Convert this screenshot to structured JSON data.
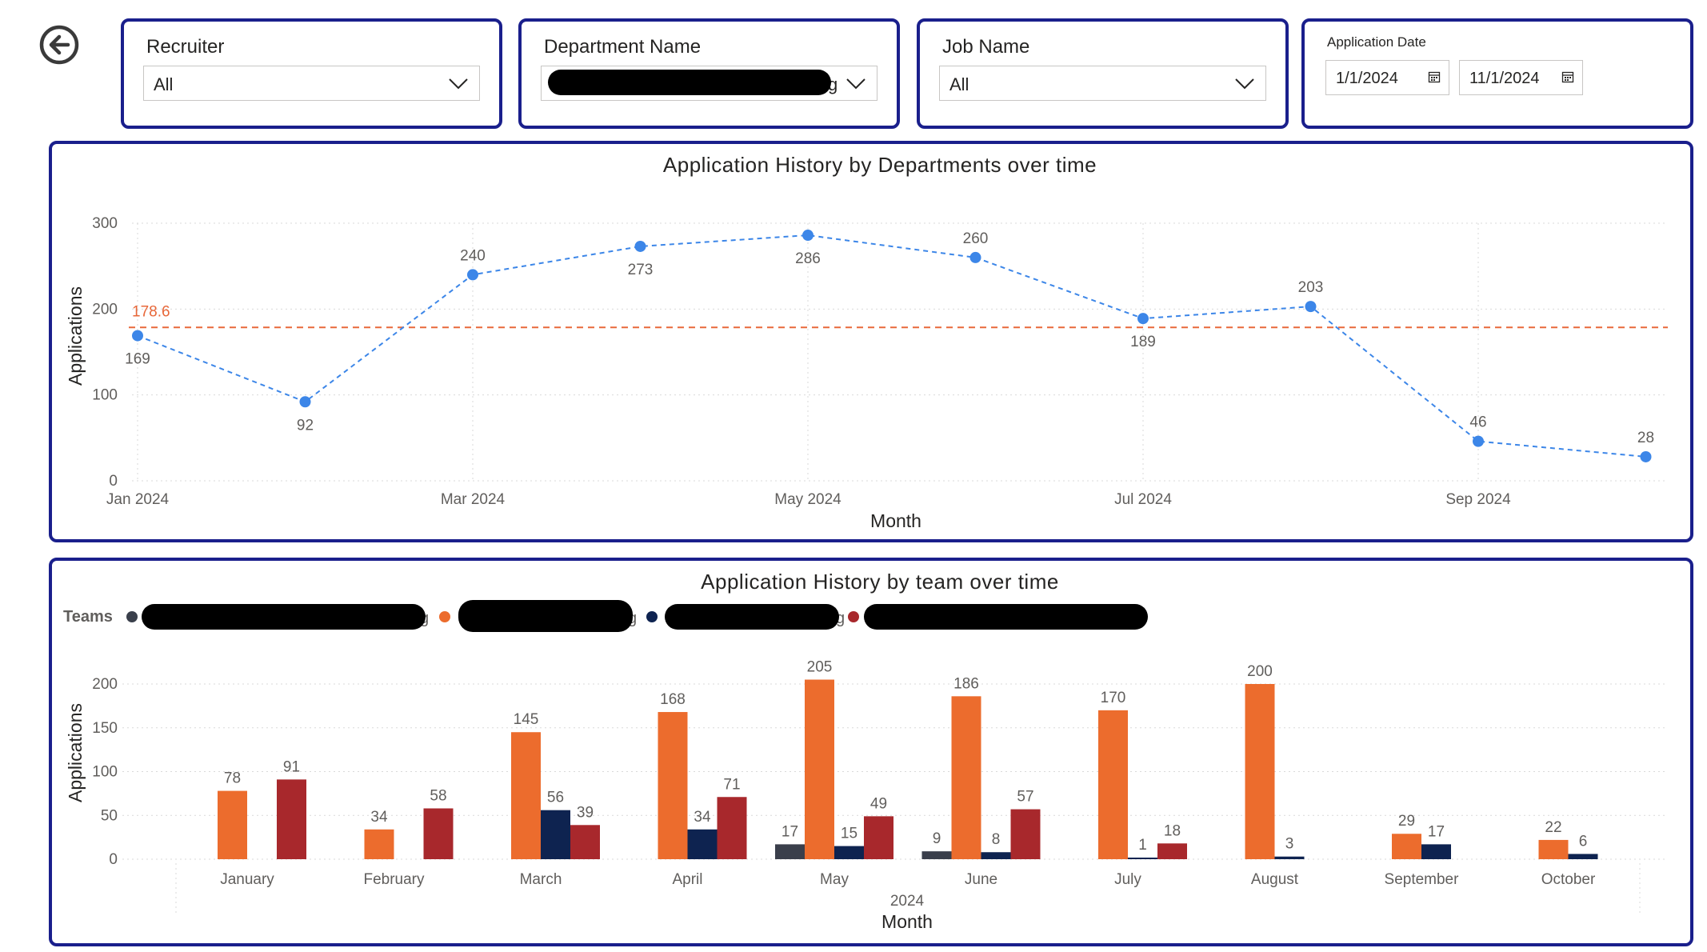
{
  "filters": {
    "recruiter": {
      "title": "Recruiter",
      "value": "All"
    },
    "department": {
      "title": "Department Name",
      "value_visible_fragment": "g"
    },
    "job": {
      "title": "Job Name",
      "value": "All"
    },
    "application_date": {
      "title": "Application Date",
      "start": "1/1/2024",
      "end": "11/1/2024"
    }
  },
  "icons": {
    "back": "back-arrow-circle-icon",
    "dropdown": "chevron-down-icon",
    "calendar": "calendar-icon"
  },
  "colors": {
    "panel_border": "#1a1f8c",
    "line_series": "#3c86e8",
    "average_line": "#e8683a",
    "team_dark_gray": "#3a3f4b",
    "team_orange": "#ec6c2d",
    "team_navy": "#0e2350",
    "team_red": "#a8282c"
  },
  "chart_data": [
    {
      "type": "line",
      "title": "Application History by Departments over time",
      "xlabel": "Month",
      "ylabel": "Applications",
      "x": [
        "Jan 2024",
        "Feb 2024",
        "Mar 2024",
        "Apr 2024",
        "May 2024",
        "Jun 2024",
        "Jul 2024",
        "Aug 2024",
        "Sep 2024",
        "Oct 2024"
      ],
      "x_tick_labels": [
        "Jan 2024",
        "Mar 2024",
        "May 2024",
        "Jul 2024",
        "Sep 2024"
      ],
      "values": [
        169,
        92,
        240,
        273,
        286,
        260,
        189,
        203,
        46,
        28
      ],
      "average": 178.6,
      "ylim": [
        0,
        300
      ],
      "yticks": [
        0,
        100,
        200,
        300
      ],
      "grid": true,
      "line_style": "dashed"
    },
    {
      "type": "bar",
      "title": "Application History by team over time",
      "legend_title": "Teams",
      "legend_placement": "top-left",
      "xlabel": "Month",
      "x_group_label": "2024",
      "ylabel": "Applications",
      "categories": [
        "January",
        "February",
        "March",
        "April",
        "May",
        "June",
        "July",
        "August",
        "September",
        "October"
      ],
      "ylim": [
        0,
        200
      ],
      "yticks": [
        0,
        50,
        100,
        150,
        200
      ],
      "grid": true,
      "series": [
        {
          "legend_visible_fragment": "g",
          "color": "#3a3f4b",
          "values": [
            null,
            null,
            null,
            null,
            17,
            9,
            null,
            null,
            null,
            null
          ]
        },
        {
          "legend_visible_fragment": "g",
          "color": "#ec6c2d",
          "values": [
            78,
            34,
            145,
            168,
            205,
            186,
            170,
            200,
            29,
            22
          ]
        },
        {
          "legend_visible_fragment": "g",
          "color": "#0e2350",
          "values": [
            null,
            null,
            56,
            34,
            15,
            8,
            1,
            3,
            17,
            6
          ]
        },
        {
          "legend_visible_fragment": "",
          "color": "#a8282c",
          "values": [
            91,
            58,
            39,
            71,
            49,
            57,
            18,
            null,
            null,
            null
          ]
        }
      ]
    }
  ]
}
